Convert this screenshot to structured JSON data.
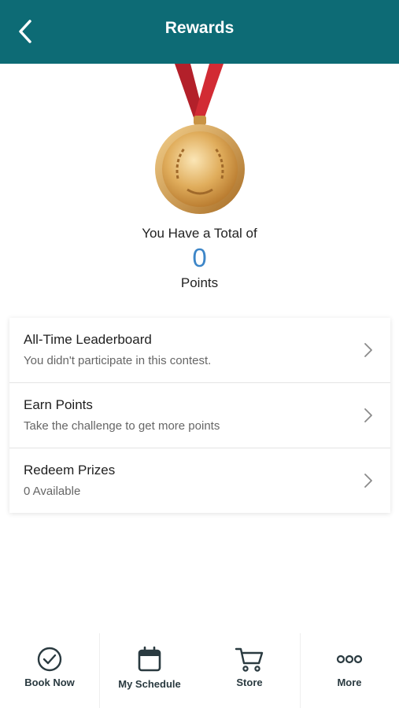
{
  "header": {
    "title": "Rewards",
    "back_icon": "chevron-left-icon",
    "background_color": "#0d6b75"
  },
  "summary": {
    "total_label": "You Have a Total of",
    "points_value": "0",
    "points_label": "Points",
    "medal_icon": "gold-medal-icon",
    "points_color": "#3d86c8"
  },
  "rows": [
    {
      "title": "All-Time Leaderboard",
      "subtitle": "You didn't participate in this contest."
    },
    {
      "title": "Earn Points",
      "subtitle": "Take the challenge to get more points"
    },
    {
      "title": "Redeem Prizes",
      "subtitle": "0 Available"
    }
  ],
  "nav": {
    "items": [
      {
        "label": "Book Now",
        "icon": "check-circle-icon"
      },
      {
        "label": "My Schedule",
        "icon": "calendar-icon"
      },
      {
        "label": "Store",
        "icon": "cart-icon"
      },
      {
        "label": "More",
        "icon": "more-dots-icon"
      }
    ]
  }
}
